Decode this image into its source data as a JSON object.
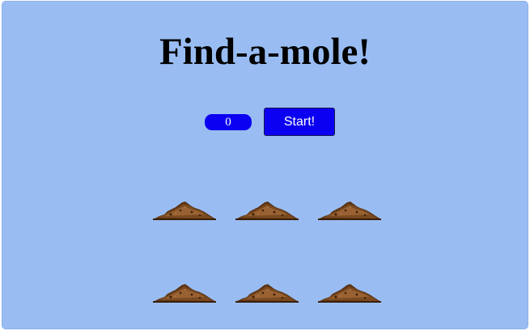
{
  "game": {
    "title": "Find-a-mole!",
    "score": "0",
    "start_label": "Start!"
  },
  "holes": [
    {
      "name": "mole-hole-1"
    },
    {
      "name": "mole-hole-2"
    },
    {
      "name": "mole-hole-3"
    },
    {
      "name": "mole-hole-4"
    },
    {
      "name": "mole-hole-5"
    },
    {
      "name": "mole-hole-6"
    }
  ],
  "colors": {
    "background": "#99bdf3",
    "button": "#0b00f2",
    "dirt_dark": "#4a2a10",
    "dirt_mid": "#7a4a20",
    "dirt_light": "#9a6233"
  }
}
